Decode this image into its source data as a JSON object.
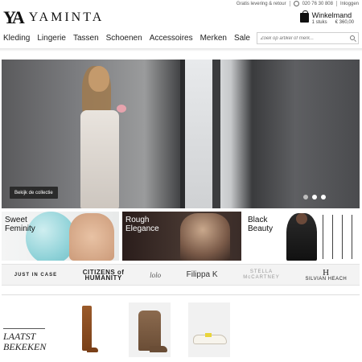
{
  "brand": {
    "mark": "YA",
    "name": "YAMINTA"
  },
  "utility": {
    "shipping": "Gratis levering & retour",
    "phone": "020 76 30 808",
    "login": "Inloggen"
  },
  "cart": {
    "title": "Winkelmand",
    "items": "1 stuks",
    "total": "€ 360,00"
  },
  "nav": {
    "items": [
      "Kleding",
      "Lingerie",
      "Tassen",
      "Schoenen",
      "Accessoires",
      "Merken",
      "Sale"
    ]
  },
  "search": {
    "placeholder": "Zoek op artikel of merk..."
  },
  "hero": {
    "button_label": "Bekijk de collectie",
    "slides": 3,
    "active_slide": 2
  },
  "tiles": [
    {
      "label": "Sweet\nFeminity"
    },
    {
      "label": "Rough\nElegance"
    },
    {
      "label": "Black\nBeauty"
    }
  ],
  "brands": {
    "b1": "JUST IN CASE",
    "b2": "CITIZENS of HUMANITY",
    "b3": "lolo",
    "b4": "Filippa K",
    "b5": "STELLA McCARTNEY",
    "b6": "SILVIAN HEACH"
  },
  "recently_viewed": {
    "title": "LAATST\nBEKEKEN"
  }
}
